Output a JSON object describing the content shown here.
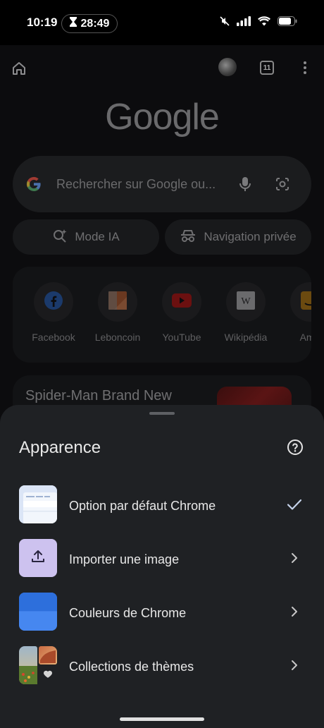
{
  "status_bar": {
    "time": "10:19",
    "timer": "28:49"
  },
  "toolbar": {
    "tab_count": "11"
  },
  "ntp": {
    "logo": "Google",
    "search_placeholder": "Rechercher sur Google ou...",
    "chips": [
      {
        "label": "Mode IA",
        "icon": "sparkle-search-icon"
      },
      {
        "label": "Navigation privée",
        "icon": "incognito-icon"
      }
    ],
    "shortcuts": [
      {
        "label": "Facebook",
        "icon": "facebook-icon",
        "color": "#1877f2"
      },
      {
        "label": "Leboncoin",
        "icon": "leboncoin-icon",
        "color": "#ec5a13"
      },
      {
        "label": "YouTube",
        "icon": "youtube-icon",
        "color": "#ff0000"
      },
      {
        "label": "Wikipédia",
        "icon": "wikipedia-icon",
        "color": "#ffffff"
      },
      {
        "label": "Ama",
        "icon": "amazon-icon",
        "color": "#ff9900"
      }
    ],
    "article_title": "Spider-Man Brand New"
  },
  "sheet": {
    "title": "Apparence",
    "options": [
      {
        "label": "Option par défaut Chrome",
        "trailing": "check-icon",
        "selected": true
      },
      {
        "label": "Importer une image",
        "trailing": "chevron-right-icon"
      },
      {
        "label": "Couleurs de Chrome",
        "trailing": "chevron-right-icon"
      },
      {
        "label": "Collections de thèmes",
        "trailing": "chevron-right-icon"
      }
    ]
  },
  "colors": {
    "sheet_bg": "#1f2124",
    "accent_blue": "#3d7de8",
    "upload_tile": "#cdc2ef"
  }
}
